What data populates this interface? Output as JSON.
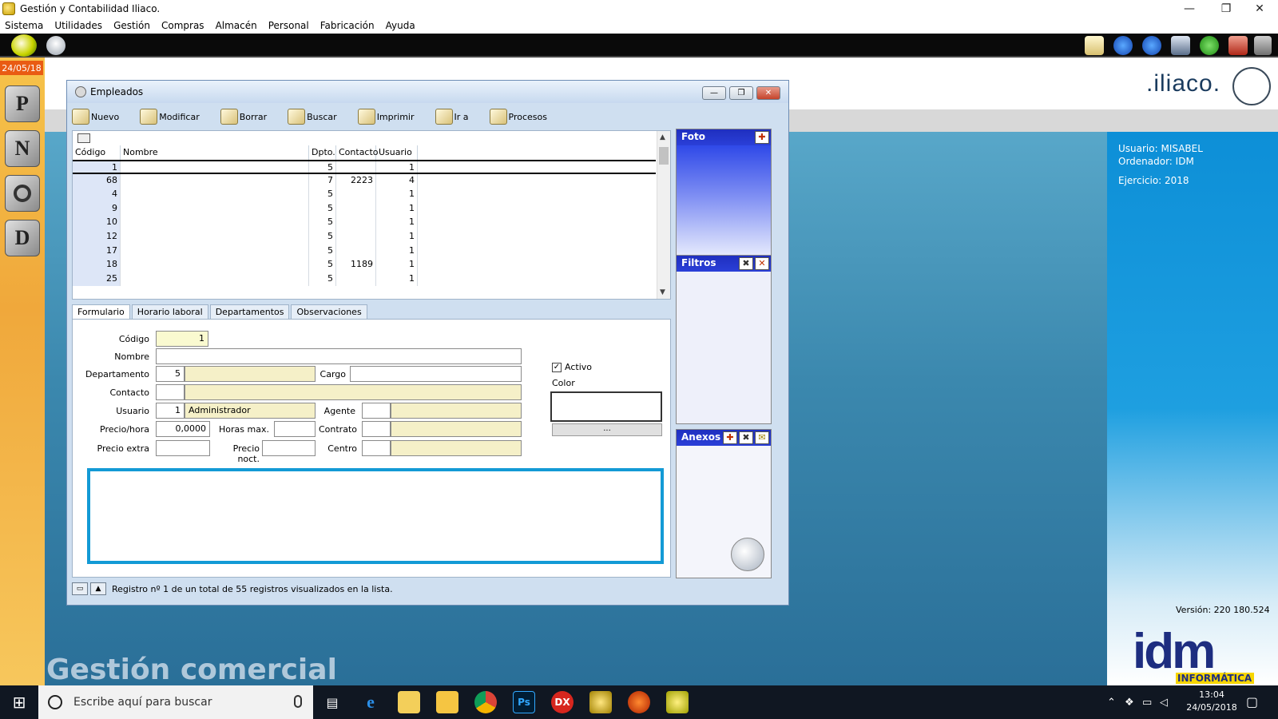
{
  "window": {
    "title": "Gestión y Contabilidad Iliaco.",
    "minimize": "—",
    "maximize": "❐",
    "close": "✕"
  },
  "menu": [
    "Sistema",
    "Utilidades",
    "Gestión",
    "Compras",
    "Almacén",
    "Personal",
    "Fabricación",
    "Ayuda"
  ],
  "sidebar": {
    "date": "24/05/18",
    "buttons": [
      "P",
      "N",
      "",
      "D"
    ]
  },
  "header": {
    "logo_text": ".iliaco."
  },
  "right_panel": {
    "user": "Usuario: MISABEL",
    "computer": "Ordenador: IDM",
    "year": "Ejercicio: 2018",
    "version": "Versión: 220 180.524",
    "brand": "idm",
    "brand_sub": "INFORMÁTICA"
  },
  "watermark": "Gestión comercial",
  "employees_window": {
    "title": "Empleados",
    "toolbar": [
      "Nuevo",
      "Modificar",
      "Borrar",
      "Buscar",
      "Imprimir",
      "Ir a",
      "Procesos"
    ],
    "list": {
      "headers": [
        "Código",
        "Nombre",
        "Dpto.",
        "Contacto",
        "Usuario"
      ],
      "rows": [
        {
          "code": "1",
          "name": "",
          "dpto": "5",
          "contact": "",
          "user": "1"
        },
        {
          "code": "68",
          "name": "",
          "dpto": "7",
          "contact": "2223",
          "user": "4"
        },
        {
          "code": "4",
          "name": "",
          "dpto": "5",
          "contact": "",
          "user": "1"
        },
        {
          "code": "9",
          "name": "",
          "dpto": "5",
          "contact": "",
          "user": "1"
        },
        {
          "code": "10",
          "name": "",
          "dpto": "5",
          "contact": "",
          "user": "1"
        },
        {
          "code": "12",
          "name": "",
          "dpto": "5",
          "contact": "",
          "user": "1"
        },
        {
          "code": "17",
          "name": "",
          "dpto": "5",
          "contact": "",
          "user": "1"
        },
        {
          "code": "18",
          "name": "",
          "dpto": "5",
          "contact": "1189",
          "user": "1"
        },
        {
          "code": "25",
          "name": "",
          "dpto": "5",
          "contact": "",
          "user": "1"
        }
      ]
    },
    "tabs": [
      "Formulario",
      "Horario laboral",
      "Departamentos",
      "Observaciones"
    ],
    "form": {
      "labels": {
        "codigo": "Código",
        "nombre": "Nombre",
        "departamento": "Departamento",
        "cargo": "Cargo",
        "contacto": "Contacto",
        "usuario": "Usuario",
        "agente": "Agente",
        "precio_hora": "Precio/hora",
        "horas_max": "Horas max.",
        "contrato": "Contrato",
        "precio_extra": "Precio extra",
        "precio_noct": "Precio noct.",
        "centro": "Centro",
        "activo": "Activo",
        "color": "Color",
        "color_button": "..."
      },
      "values": {
        "codigo": "1",
        "departamento": "5",
        "usuario": "1",
        "usuario_name": "Administrador",
        "precio_hora": "0,0000"
      },
      "activo_checked": "✓"
    },
    "side_panels": {
      "foto": "Foto",
      "filtros": "Filtros",
      "anexos": "Anexos"
    },
    "status": "Registro nº 1 de un total de 55 registros visualizados en la lista."
  },
  "taskbar": {
    "search_placeholder": "Escribe aquí para buscar",
    "time": "13:04",
    "date": "24/05/2018",
    "dx_label": "DX",
    "ps_label": "Ps"
  },
  "colors": {
    "accent": "#139ad5",
    "panel_header": "#2a3fd8",
    "right_panel": "#1e9fe0",
    "sidebar": "#f0a83b"
  }
}
